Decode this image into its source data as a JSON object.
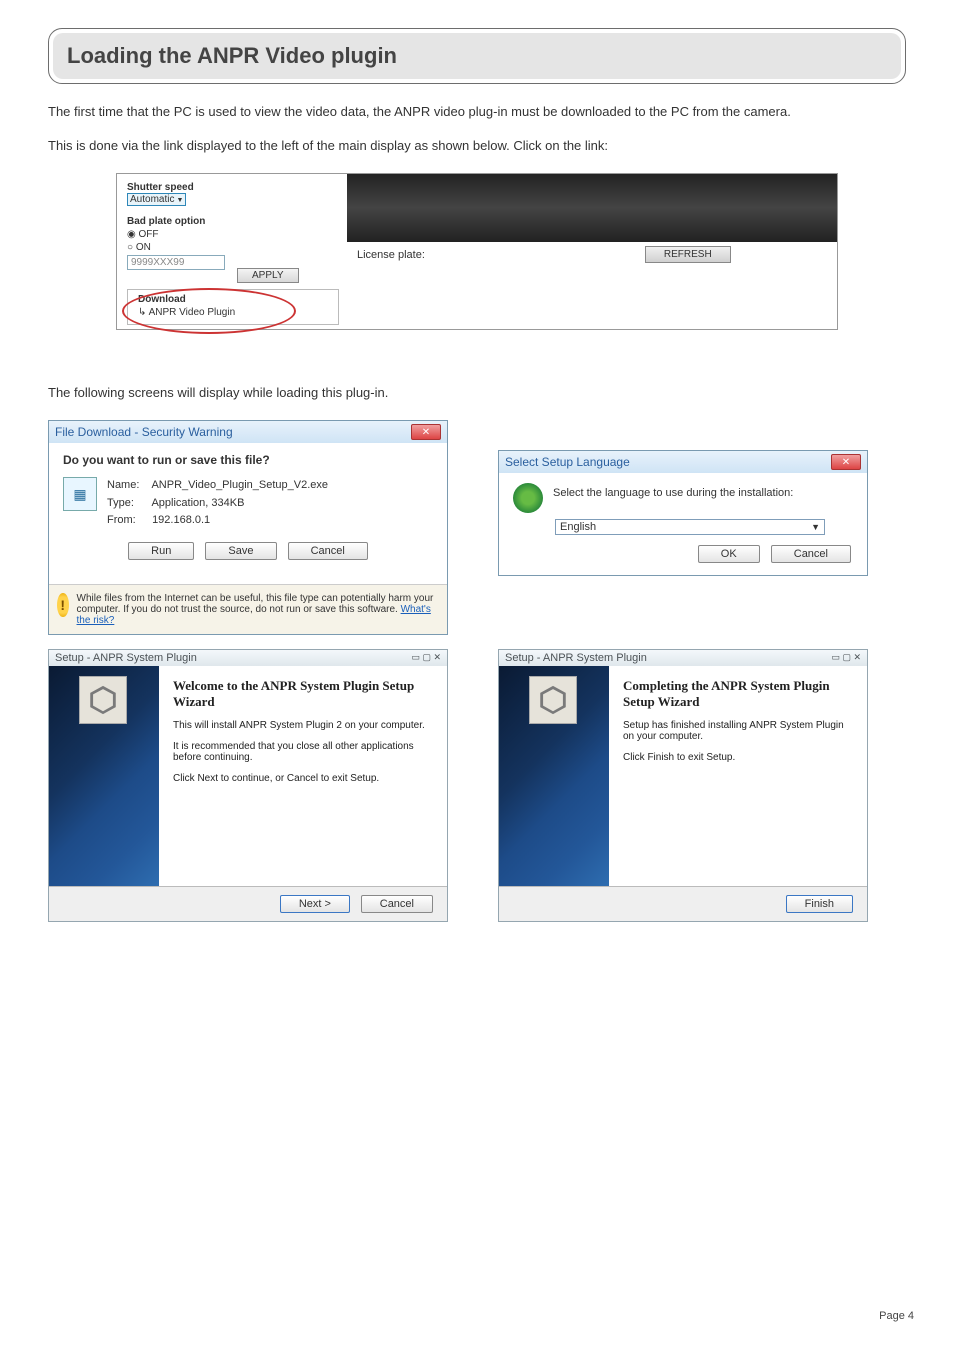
{
  "heading": "Loading the ANPR Video plugin",
  "intro": "The first time that the PC is used to view the video data, the ANPR video plug-in must be downloaded to the PC from the camera.",
  "intro2": "This is done via the link displayed to the left of the main display as shown below. Click on the link:",
  "embed1": {
    "shutter_label": "Shutter speed",
    "shutter_value": "Automatic",
    "bad_plate_label": "Bad plate option",
    "off": "OFF",
    "on": "ON",
    "plate_example": "9999XXX99",
    "apply": "APPLY",
    "download_label": "Download",
    "download_link": "ANPR Video Plugin",
    "license_plate_label": "License plate:",
    "refresh": "REFRESH"
  },
  "midtext": "The following screens will display while loading this plug-in.",
  "dl_dialog": {
    "title": "File Download - Security Warning",
    "question": "Do you want to run or save this file?",
    "name_k": "Name:",
    "name_v": "ANPR_Video_Plugin_Setup_V2.exe",
    "type_k": "Type:",
    "type_v": "Application, 334KB",
    "from_k": "From:",
    "from_v": "192.168.0.1",
    "run": "Run",
    "save": "Save",
    "cancel": "Cancel",
    "warn": "While files from the Internet can be useful, this file type can potentially harm your computer. If you do not trust the source, do not run or save this software. ",
    "risk_link": "What's the risk?"
  },
  "lang_dialog": {
    "title": "Select Setup Language",
    "msg": "Select the language to use during the installation:",
    "value": "English",
    "ok": "OK",
    "cancel": "Cancel"
  },
  "wiz1": {
    "title": "Setup - ANPR System Plugin",
    "h": "Welcome to the ANPR System Plugin Setup Wizard",
    "l1": "This will install ANPR System Plugin 2 on your computer.",
    "l2": "It is recommended that you close all other applications before continuing.",
    "l3": "Click Next to continue, or Cancel to exit Setup.",
    "next": "Next >",
    "cancel": "Cancel"
  },
  "wiz2": {
    "title": "Setup - ANPR System Plugin",
    "h": "Completing the ANPR System Plugin Setup Wizard",
    "l1": "Setup has finished installing ANPR System Plugin on your computer.",
    "l2": "Click Finish to exit Setup.",
    "finish": "Finish"
  },
  "page_num": "Page  4"
}
